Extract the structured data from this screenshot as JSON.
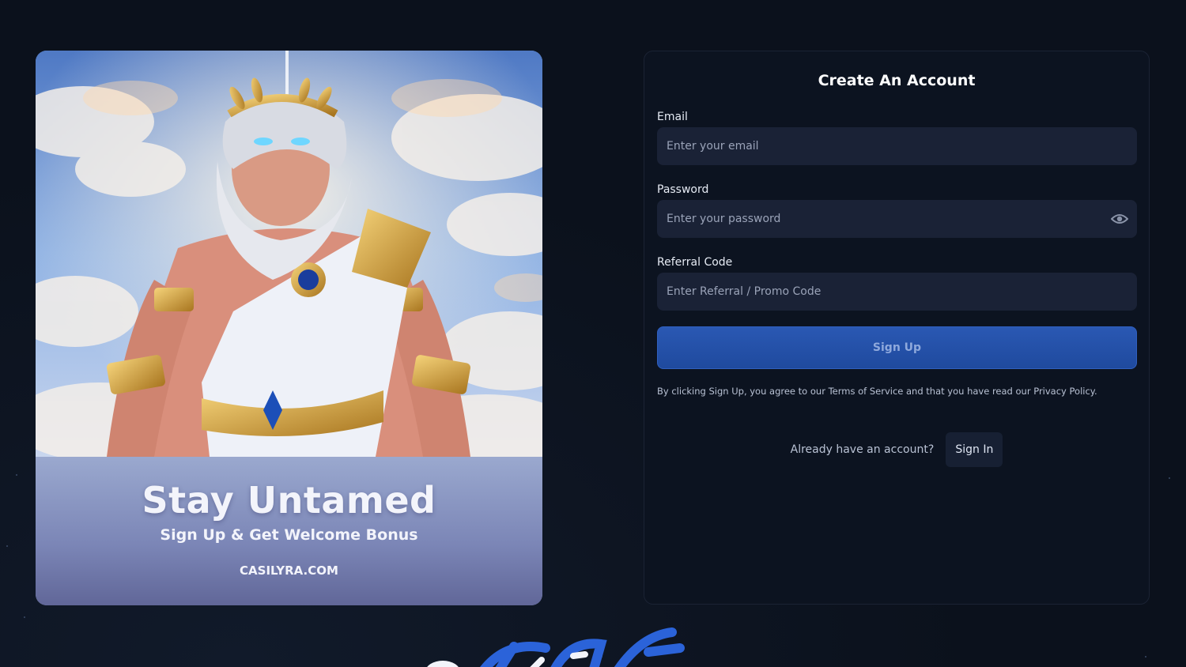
{
  "promo": {
    "title": "Stay Untamed",
    "subtitle": "Sign Up & Get Welcome Bonus",
    "site": "CASILYRA.COM"
  },
  "form": {
    "title": "Create An Account",
    "email": {
      "label": "Email",
      "placeholder": "Enter your email",
      "value": ""
    },
    "password": {
      "label": "Password",
      "placeholder": "Enter your password",
      "value": "",
      "toggle_icon": "eye-icon"
    },
    "referral": {
      "label": "Referral Code",
      "placeholder": "Enter Referral / Promo Code",
      "value": ""
    },
    "signup_label": "Sign Up",
    "terms": "By clicking Sign Up, you agree to our Terms of Service and that you have read our Privacy Policy.",
    "account_question": "Already have an account?",
    "signin_label": "Sign In"
  },
  "colors": {
    "background": "#0b111c",
    "card": "#0c1320",
    "input": "#1a2236",
    "primary": "#2a58b3",
    "deco_accent": "#2b63d9"
  }
}
